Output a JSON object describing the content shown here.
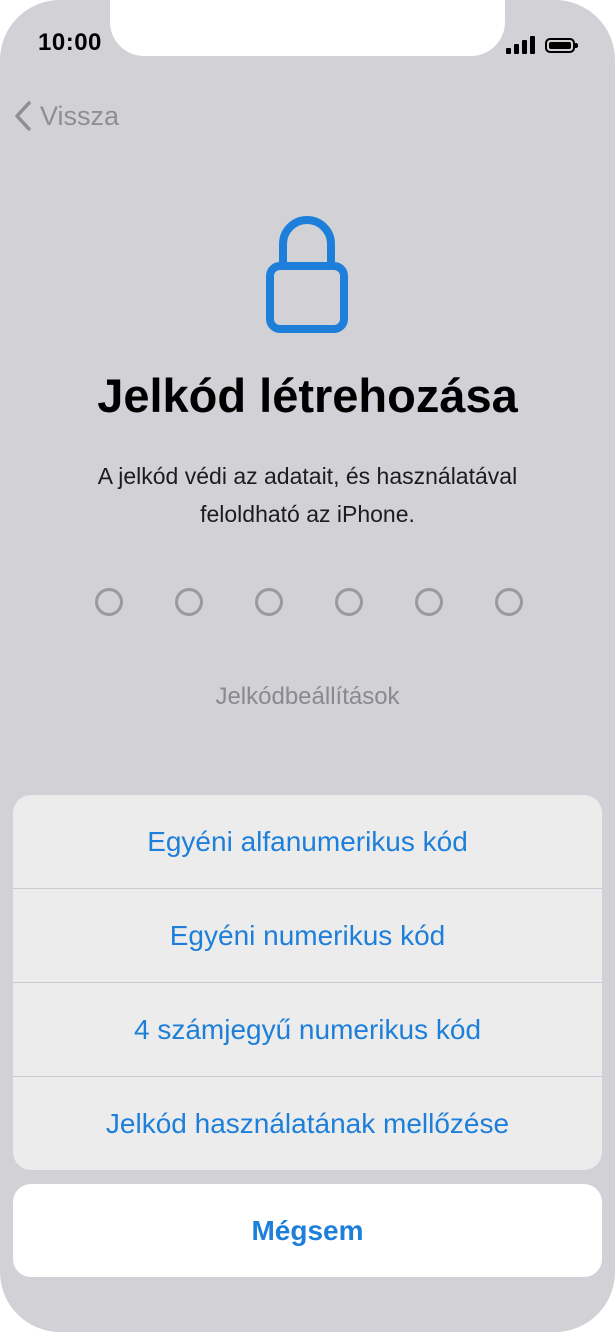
{
  "status_bar": {
    "time": "10:00",
    "icons": [
      "signal-icon",
      "battery-icon"
    ]
  },
  "nav": {
    "back_label": "Vissza",
    "back_icon": "chevron-left-icon"
  },
  "main": {
    "icon": "lock-icon",
    "title": "Jelkód létrehozása",
    "subtitle_line1": "A jelkód védi az adatait, és használatával",
    "subtitle_line2": "feloldható az iPhone.",
    "passcode_dots": 6,
    "options_link": "Jelkódbeállítások"
  },
  "action_sheet": {
    "items": [
      {
        "label": "Egyéni alfanumerikus kód"
      },
      {
        "label": "Egyéni numerikus kód"
      },
      {
        "label": "4 számjegyű numerikus kód"
      },
      {
        "label": "Jelkód használatának mellőzése"
      }
    ],
    "cancel_label": "Mégsem"
  },
  "colors": {
    "accent": "#1d7fda",
    "dimmed_background": "#d2d1d6",
    "sheet_background": "#ececec"
  }
}
